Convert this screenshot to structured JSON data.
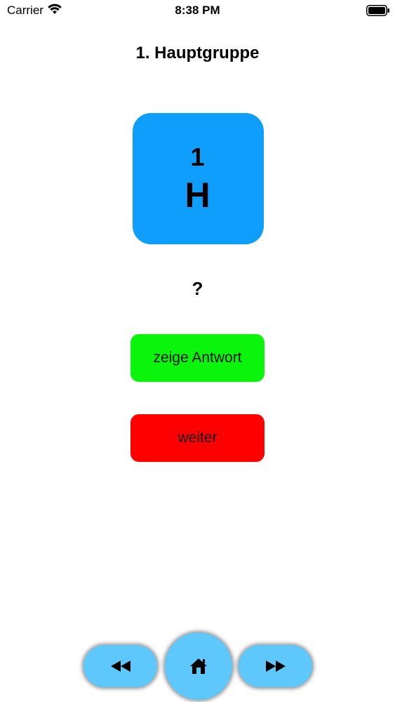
{
  "status_bar": {
    "carrier": "Carrier",
    "time": "8:38 PM"
  },
  "title": "1. Hauptgruppe",
  "element": {
    "number": "1",
    "symbol": "H",
    "color": "#0f9efc"
  },
  "question": "?",
  "buttons": {
    "show_answer": "zeige Antwort",
    "show_answer_color": "#0bf40b",
    "next": "weiter",
    "next_color": "#ff0000"
  },
  "nav": {
    "prev_icon": "rewind-icon",
    "home_icon": "home-icon",
    "next_icon": "fast-forward-icon",
    "color": "#5ec8fc"
  }
}
